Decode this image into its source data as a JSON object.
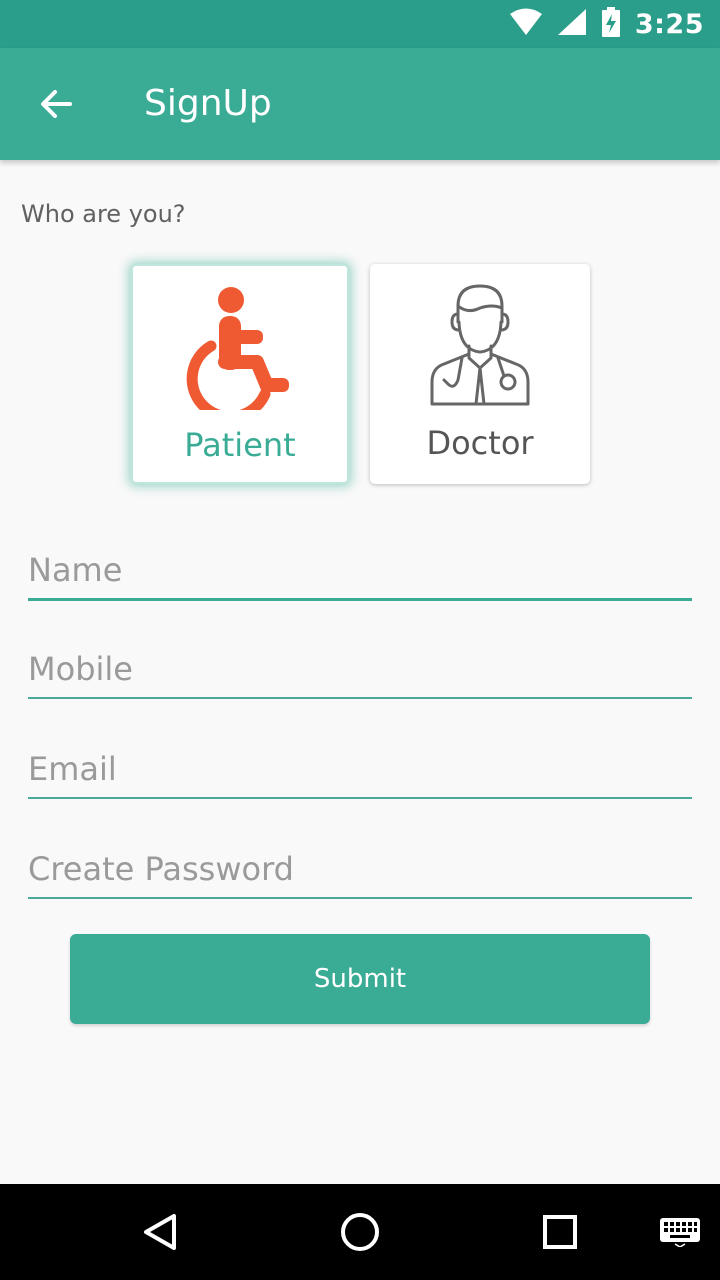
{
  "status_bar": {
    "time": "3:25",
    "icons": [
      "wifi-icon",
      "signal-icon",
      "battery-charging-icon"
    ]
  },
  "app_bar": {
    "title": "SignUp",
    "back_icon": "arrow-left-icon"
  },
  "role_selection": {
    "label": "Who are you?",
    "options": [
      {
        "label": "Patient",
        "icon": "wheelchair-icon",
        "selected": true,
        "color": "#3aac96",
        "icon_color": "#f05a33"
      },
      {
        "label": "Doctor",
        "icon": "doctor-icon",
        "selected": false
      }
    ]
  },
  "form": {
    "name_placeholder": "Name",
    "mobile_placeholder": "Mobile",
    "email_placeholder": "Email",
    "password_placeholder": "Create Password",
    "submit_label": "Submit"
  },
  "colors": {
    "primary": "#3aac96",
    "primary_dark": "#2a9e8a",
    "accent_icon": "#f05a33"
  },
  "nav_bar": {
    "icons": [
      "back-triangle-icon",
      "home-circle-icon",
      "recents-square-icon",
      "keyboard-icon"
    ]
  }
}
